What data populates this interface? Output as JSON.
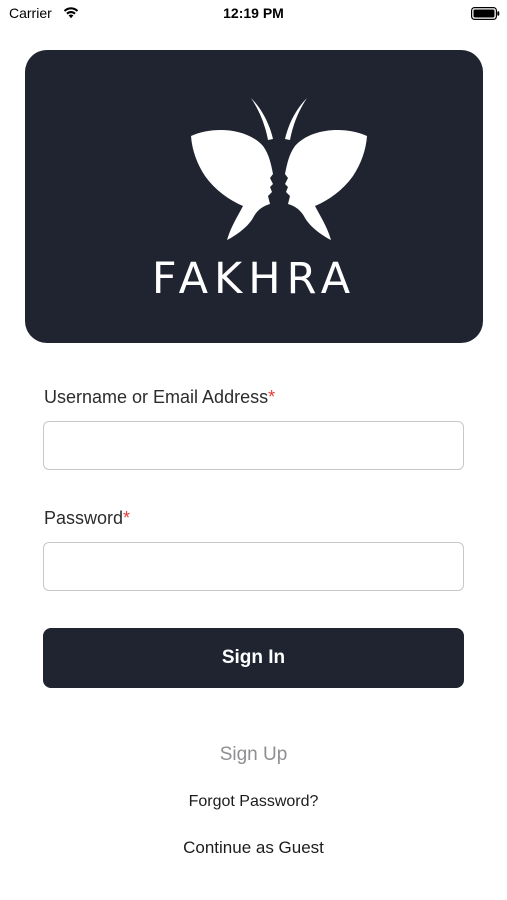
{
  "status_bar": {
    "carrier": "Carrier",
    "time": "12:19 PM",
    "icons": [
      "wifi-icon",
      "battery-icon"
    ]
  },
  "logo": {
    "brand": "FAKHRA",
    "icon": "butterfly-faces-logo",
    "card_color": "#1f2430"
  },
  "form": {
    "username": {
      "label": "Username or Email Address",
      "required_mark": "*",
      "value": "",
      "placeholder": ""
    },
    "password": {
      "label": "Password",
      "required_mark": "*",
      "value": "",
      "placeholder": ""
    },
    "sign_in_label": "Sign In"
  },
  "links": {
    "sign_up": "Sign Up",
    "forgot_password": "Forgot Password?",
    "guest": "Continue as Guest"
  },
  "colors": {
    "primary": "#1f2430",
    "required": "#e53935",
    "muted": "#8e8e93"
  }
}
